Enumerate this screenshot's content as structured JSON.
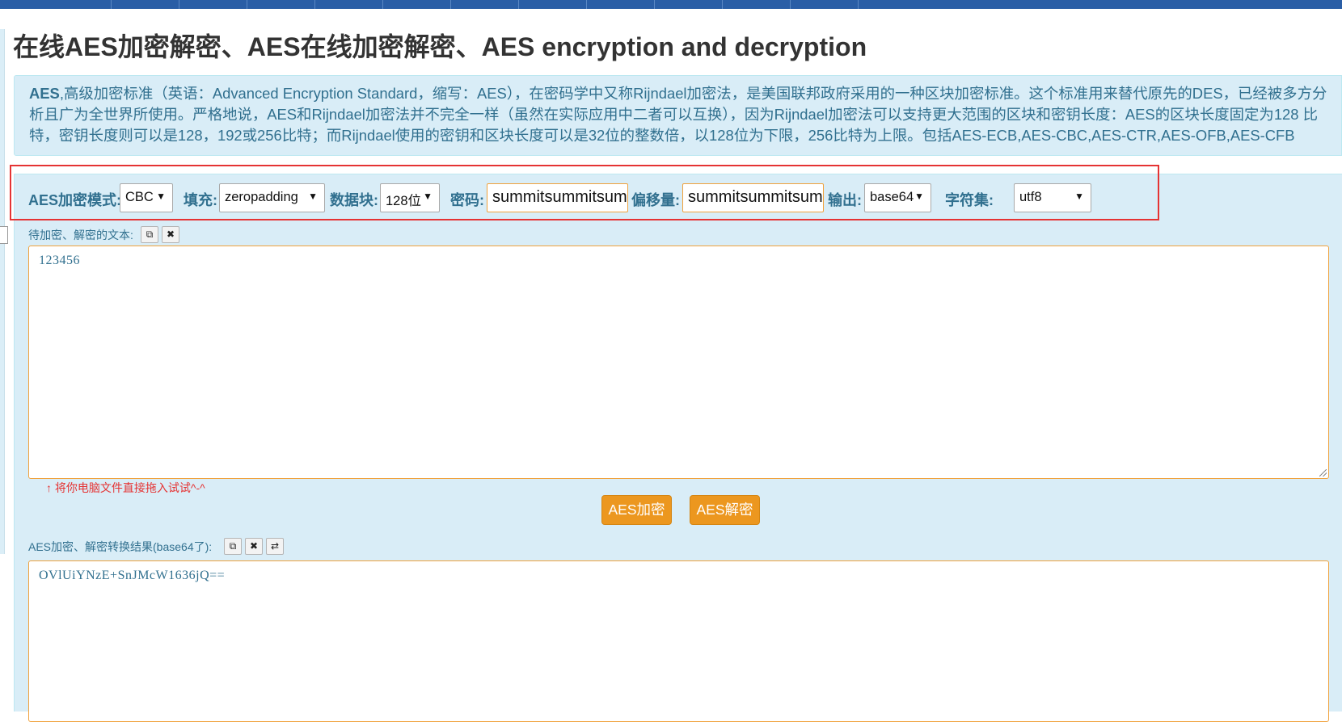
{
  "page": {
    "title": "在线AES加密解密、AES在线加密解密、AES encryption and decryption"
  },
  "intro": {
    "bold": "AES",
    "text": ",高级加密标准（英语：Advanced Encryption Standard，缩写：AES），在密码学中又称Rijndael加密法，是美国联邦政府采用的一种区块加密标准。这个标准用来替代原先的DES，已经被多方分析且广为全世界所使用。严格地说，AES和Rijndael加密法并不完全一样（虽然在实际应用中二者可以互换），因为Rijndael加密法可以支持更大范围的区块和密钥长度：AES的区块长度固定为128 比特，密钥长度则可以是128，192或256比特；而Rijndael使用的密钥和区块长度可以是32位的整数倍，以128位为下限，256比特为上限。包括AES-ECB,AES-CBC,AES-CTR,AES-OFB,AES-CFB"
  },
  "controls": {
    "mode_label": "AES加密模式:",
    "mode_value": "CBC",
    "padding_label": "填充:",
    "padding_value": "zeropadding",
    "block_label": "数据块:",
    "block_value": "128位",
    "key_label": "密码:",
    "key_value": "summitsummitsummit",
    "iv_label": "偏移量:",
    "iv_value": "summitsummitsummit",
    "output_label": "输出:",
    "output_value": "base64",
    "charset_label": "字符集:",
    "charset_value": "utf8"
  },
  "input_section": {
    "label": "待加密、解密的文本:",
    "copy_icon": "copy-icon",
    "clear_icon": "clear-icon",
    "value": "123456",
    "hint": "↑ 将你电脑文件直接拖入试试^-^"
  },
  "buttons": {
    "encrypt": "AES加密",
    "decrypt": "AES解密"
  },
  "output_section": {
    "label": "AES加密、解密转换结果(base64了):",
    "copy_icon": "copy-icon",
    "clear_icon": "clear-icon",
    "swap_icon": "swap-icon",
    "value": "OVlUiYNzE+SnJMcW1636jQ=="
  },
  "colors": {
    "nav": "#2a5ea6",
    "panel_bg": "#d9edf7",
    "panel_text": "#31708f",
    "accent_orange": "#ec971f",
    "highlight_red": "#e53333"
  }
}
